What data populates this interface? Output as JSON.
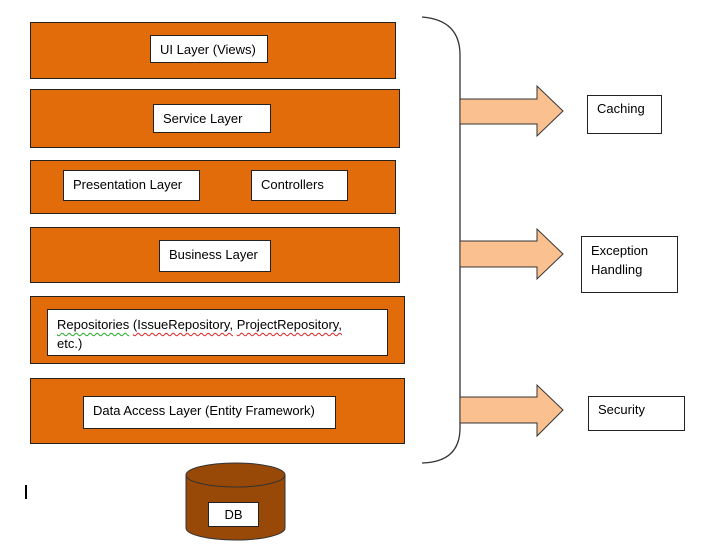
{
  "colors": {
    "layer_fill": "#E36C0A",
    "db_fill": "#984807",
    "arrow_fill": "#FAC090"
  },
  "layers": [
    {
      "boxes": [
        "UI Layer (Views)"
      ]
    },
    {
      "boxes": [
        "Service Layer"
      ]
    },
    {
      "boxes": [
        "Presentation Layer",
        "Controllers"
      ]
    },
    {
      "boxes": [
        "Business Layer"
      ]
    },
    {
      "repositories": {
        "word1": "Repositories",
        "word2": "(IssueRepository,",
        "word3": "ProjectRepository,",
        "rest": "etc.)"
      }
    },
    {
      "boxes": [
        "Data Access Layer (Entity Framework)"
      ]
    }
  ],
  "database": {
    "label": "DB"
  },
  "concerns": [
    {
      "label": "Caching"
    },
    {
      "line1": "Exception",
      "line2": "Handling"
    },
    {
      "label": "Security"
    }
  ]
}
